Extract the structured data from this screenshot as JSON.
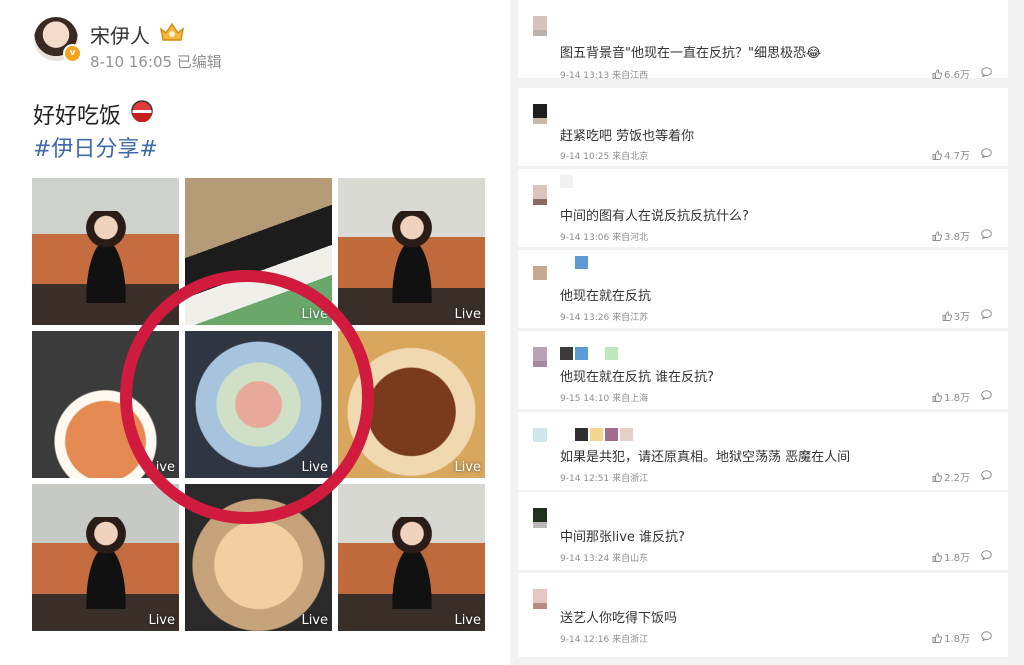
{
  "post": {
    "author": "宋伊人",
    "meta": "8-10 16:05 已编辑",
    "text": "好好吃饭",
    "tag": "#伊日分享#",
    "live_label": "Live",
    "photos": [
      {
        "live": false,
        "subject": "person"
      },
      {
        "live": true,
        "subject": "table"
      },
      {
        "live": true,
        "subject": "person"
      },
      {
        "live": true,
        "subject": "pizza"
      },
      {
        "live": true,
        "subject": "sashimi"
      },
      {
        "live": true,
        "subject": "noodles"
      },
      {
        "live": true,
        "subject": "person"
      },
      {
        "live": true,
        "subject": "ramen"
      },
      {
        "live": true,
        "subject": "person"
      }
    ]
  },
  "comments": [
    {
      "text": "图五背景音\"他现在一直在反抗？\"细思极恐😂",
      "meta": "9-14 13:13 来自江西",
      "likes": "6.6万"
    },
    {
      "text": "赶紧吃吧 劳饭也等着你",
      "meta": "9-14 10:25 来自北京",
      "likes": "4.7万"
    },
    {
      "text": "中间的图有人在说反抗反抗什么?",
      "meta": "9-14 13:06 来自河北",
      "likes": "3.8万"
    },
    {
      "text": "他现在就在反抗",
      "meta": "9-14 13:26 来自江苏",
      "likes": "3万"
    },
    {
      "text": "他现在就在反抗 谁在反抗?",
      "meta": "9-15 14:10 来自上海",
      "likes": "1.8万"
    },
    {
      "text": "如果是共犯，请还原真相。地狱空荡荡 恶魔在人间",
      "meta": "9-14 12:51 来自浙江",
      "likes": "2.2万"
    },
    {
      "text": "中间那张live 谁反抗?",
      "meta": "9-14 13:24 来自山东",
      "likes": "1.8万"
    },
    {
      "text": "送艺人你吃得下饭吗",
      "meta": "9-14 12:16 来自浙江",
      "likes": "1.8万"
    }
  ],
  "colors": {
    "accent_tag": "#3f6aa5",
    "annotation_circle": "#d01b3f",
    "verified_badge": "#f7a21b"
  }
}
